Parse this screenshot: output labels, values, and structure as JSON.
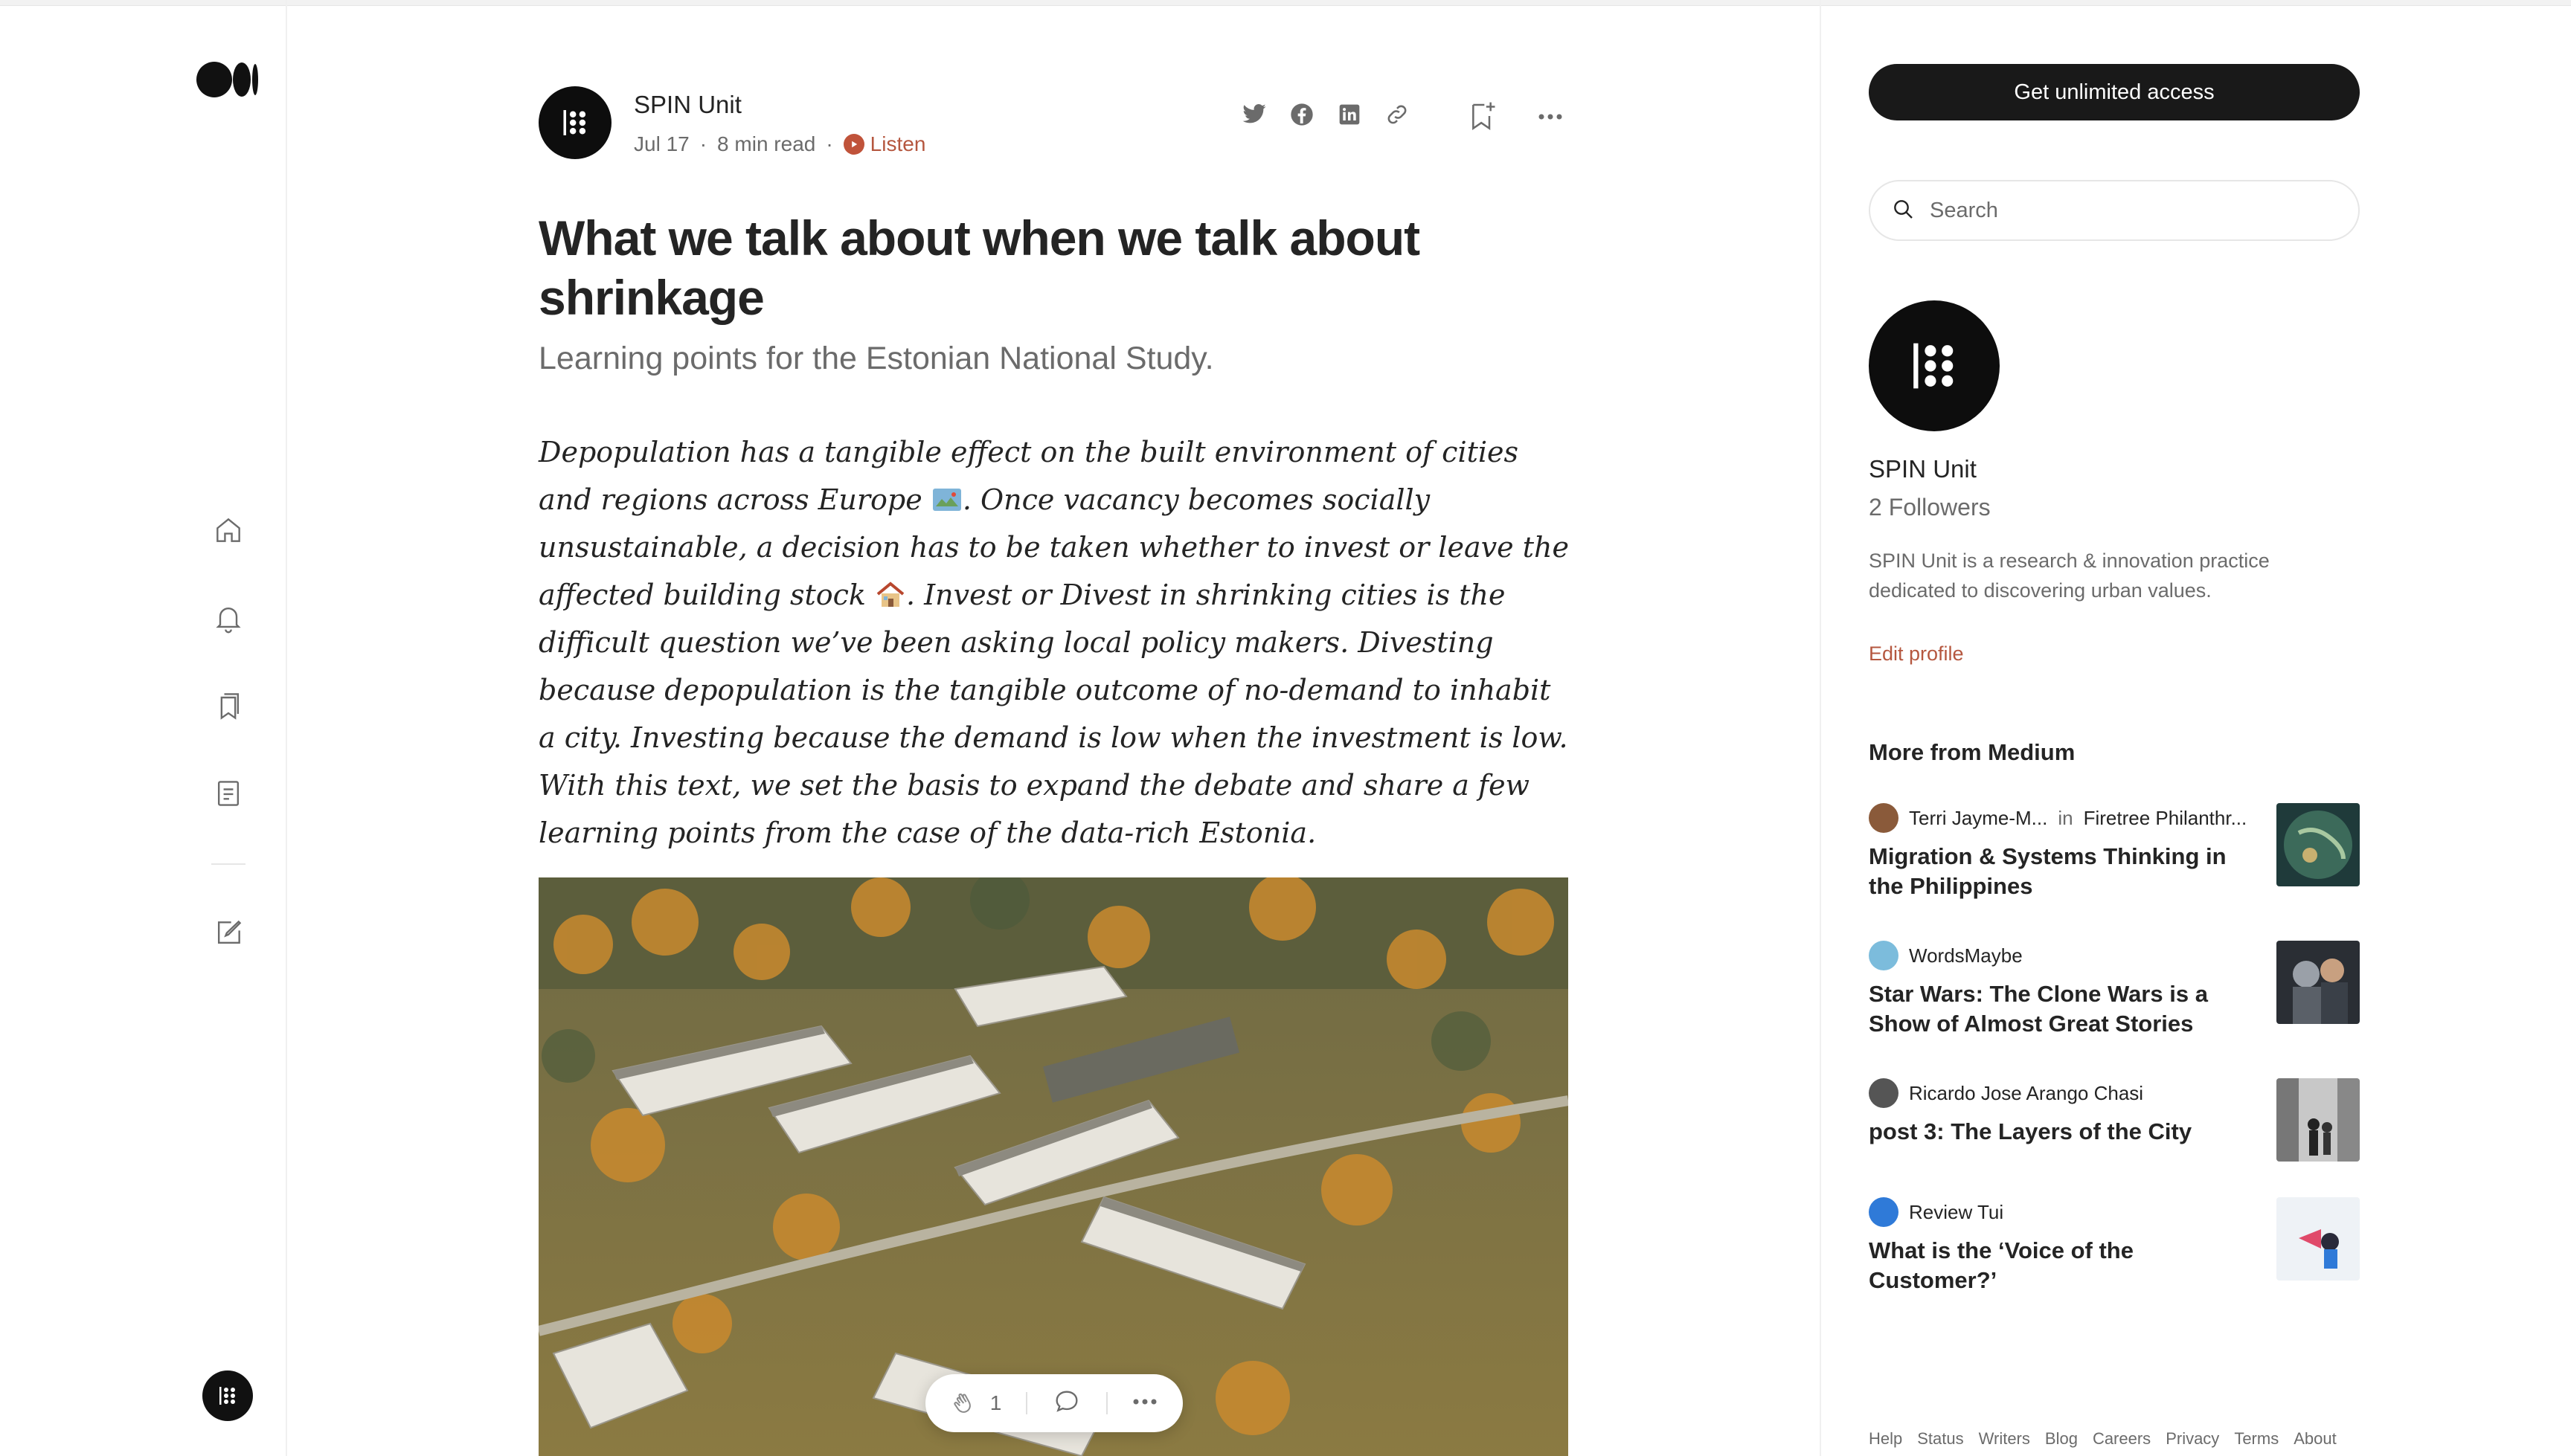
{
  "nav": {
    "logo": "medium-logo",
    "icons": [
      "home-icon",
      "bell-icon",
      "bookmarks-icon",
      "stories-icon",
      "write-icon"
    ]
  },
  "article": {
    "author": "SPIN Unit",
    "date": "Jul 17",
    "read_time": "8 min read",
    "listen_label": "Listen",
    "title": "What we talk about when we talk about shrinkage",
    "subtitle": "Learning points for the Estonian National Study.",
    "body_part1": "Depopulation has a tangible effect on the built environment of cities and regions across Europe ",
    "body_part2": ". Once vacancy becomes socially unsustainable, a decision has to be taken whether to invest or leave the affected building stock ",
    "body_part3": ". Invest or Divest in shrinking cities is the difficult question we’ve been asking local policy makers. Divesting because depopulation is the tangible outcome of no-demand to inhabit a city. Investing because the demand is low when the investment is low. With this text, we set the basis to expand the debate and share a few learning points from the case of the data-rich Estonia.",
    "clap_count": "1",
    "share_icons": [
      "twitter-icon",
      "facebook-icon",
      "linkedin-icon",
      "link-icon"
    ]
  },
  "sidebar": {
    "cta_label": "Get unlimited access",
    "search_placeholder": "Search",
    "profile": {
      "name": "SPIN Unit",
      "followers": "2 Followers",
      "bio": "SPIN Unit is a research & innovation practice dedicated to discovering urban values.",
      "edit_label": "Edit profile"
    },
    "more_heading": "More from Medium",
    "stories": [
      {
        "author": "Terri Jayme-M...",
        "in_label": "in",
        "publication": "Firetree Philanthr...",
        "title": "Migration & Systems Thinking in the Philippines"
      },
      {
        "author": "WordsMaybe",
        "title": "Star Wars: The Clone Wars is a Show of Almost Great Stories"
      },
      {
        "author": "Ricardo Jose Arango Chasi",
        "title": "post 3: The Layers of the City"
      },
      {
        "author": "Review Tui",
        "title": "What is the ‘Voice of the Customer?’"
      }
    ],
    "footer": [
      "Help",
      "Status",
      "Writers",
      "Blog",
      "Careers",
      "Privacy",
      "Terms",
      "About"
    ]
  },
  "colors": {
    "accent": "#b5573f",
    "text": "#242424",
    "muted": "#6b6b6b",
    "cta_bg": "#191919"
  }
}
